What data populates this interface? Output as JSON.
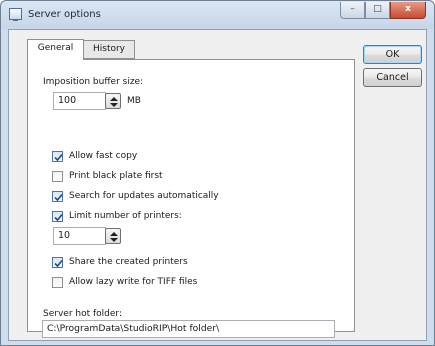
{
  "window": {
    "title": "Server options",
    "controls": {
      "minimize": "–",
      "maximize": "□",
      "close": "x"
    }
  },
  "tabs": [
    {
      "label": "General",
      "active": true
    },
    {
      "label": "History",
      "active": false
    }
  ],
  "general": {
    "imposition_buffer": {
      "label": "Imposition buffer size:",
      "value": "100",
      "unit": "MB"
    },
    "options": [
      {
        "label": "Allow fast copy",
        "checked": true
      },
      {
        "label": "Print black plate first",
        "checked": false
      },
      {
        "label": "Search for updates automatically",
        "checked": true
      },
      {
        "label": "Limit number of printers:",
        "checked": true
      }
    ],
    "printer_limit": {
      "value": "10"
    },
    "options2": [
      {
        "label": "Share the created printers",
        "checked": true
      },
      {
        "label": "Allow lazy write for TIFF files",
        "checked": false
      }
    ],
    "hot_folder": {
      "label": "Server hot folder:",
      "value": "C:\\ProgramData\\StudioRIP\\Hot folder\\"
    }
  },
  "buttons": {
    "ok": "OK",
    "cancel": "Cancel"
  }
}
